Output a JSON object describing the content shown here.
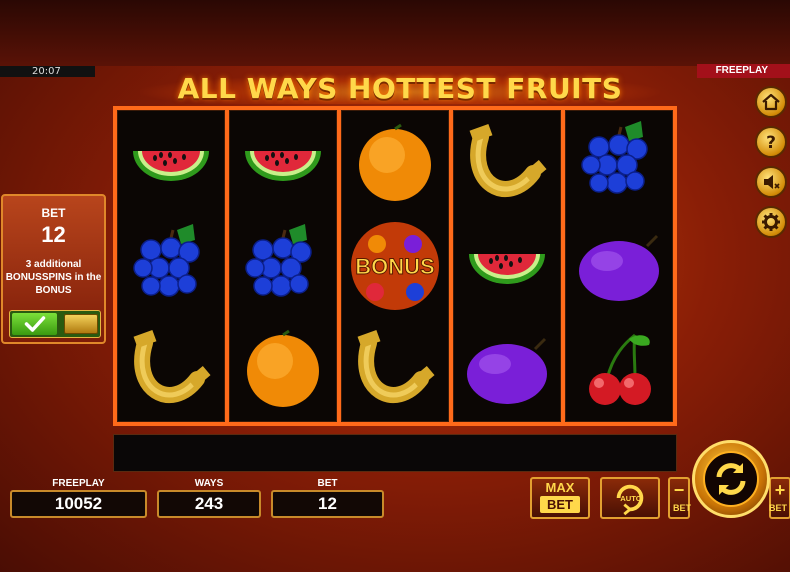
{
  "clock": "20:07",
  "mode_tag": "FREEPLAY",
  "title": "ALL WAYS HOTTEST FRUITS",
  "reels": [
    [
      "watermelon",
      "grapes",
      "horseshoe"
    ],
    [
      "watermelon",
      "grapes",
      "orange"
    ],
    [
      "orange",
      "bonus",
      "horseshoe"
    ],
    [
      "horseshoe",
      "watermelon",
      "plum"
    ],
    [
      "grapes",
      "plum",
      "cherries"
    ]
  ],
  "bonus_symbol_text": "BONUS",
  "bet_panel": {
    "label": "BET",
    "value": "12",
    "info": "3 additional BONUSSPINS in the BONUS",
    "toggle_on": true
  },
  "counters": {
    "freeplay_label": "FREEPLAY",
    "freeplay_value": "10052",
    "ways_label": "WAYS",
    "ways_value": "243",
    "bet_label": "BET",
    "bet_value": "12"
  },
  "buttons": {
    "maxbet_top": "MAX",
    "maxbet_bottom": "BET",
    "auto": "AUTO",
    "minus": "−",
    "plus": "+",
    "bet_small_left": "BET",
    "bet_small_right": "BET"
  },
  "side_icons": [
    "home-icon",
    "help-icon",
    "sound-mute-icon",
    "settings-icon"
  ],
  "colors": {
    "accent_gold": "#ffd84a",
    "reel_frame": "#ff6a1a",
    "tag_red": "#a3101a"
  }
}
